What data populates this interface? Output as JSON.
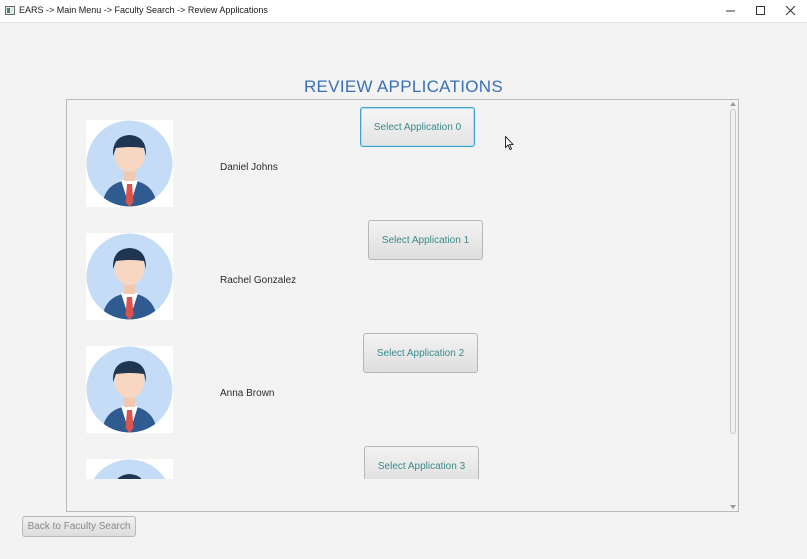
{
  "window": {
    "title": "EARS -> Main Menu -> Faculty Search -> Review Applications",
    "app_icon": "app-window-icon",
    "controls": [
      "minimize-icon",
      "maximize-icon",
      "close-icon"
    ]
  },
  "page": {
    "heading": "REVIEW APPLICATIONS",
    "heading_color": "#3b6fb6"
  },
  "applications": [
    {
      "name": "Daniel Johns",
      "button_label": "Select Application 0",
      "avatar": "person-avatar-icon",
      "focused": true
    },
    {
      "name": "Rachel Gonzalez",
      "button_label": "Select Application 1",
      "avatar": "person-avatar-icon",
      "focused": false
    },
    {
      "name": "Anna Brown",
      "button_label": "Select Application 2",
      "avatar": "person-avatar-icon",
      "focused": false
    },
    {
      "name": "",
      "button_label": "Select Application 3",
      "avatar": "person-avatar-icon",
      "focused": false
    }
  ],
  "footer": {
    "back_label": "Back to Faculty Search"
  },
  "colors": {
    "button_text": "#3a8a8c",
    "focus_border": "#3f9fd0",
    "background": "#f3f3f3"
  }
}
